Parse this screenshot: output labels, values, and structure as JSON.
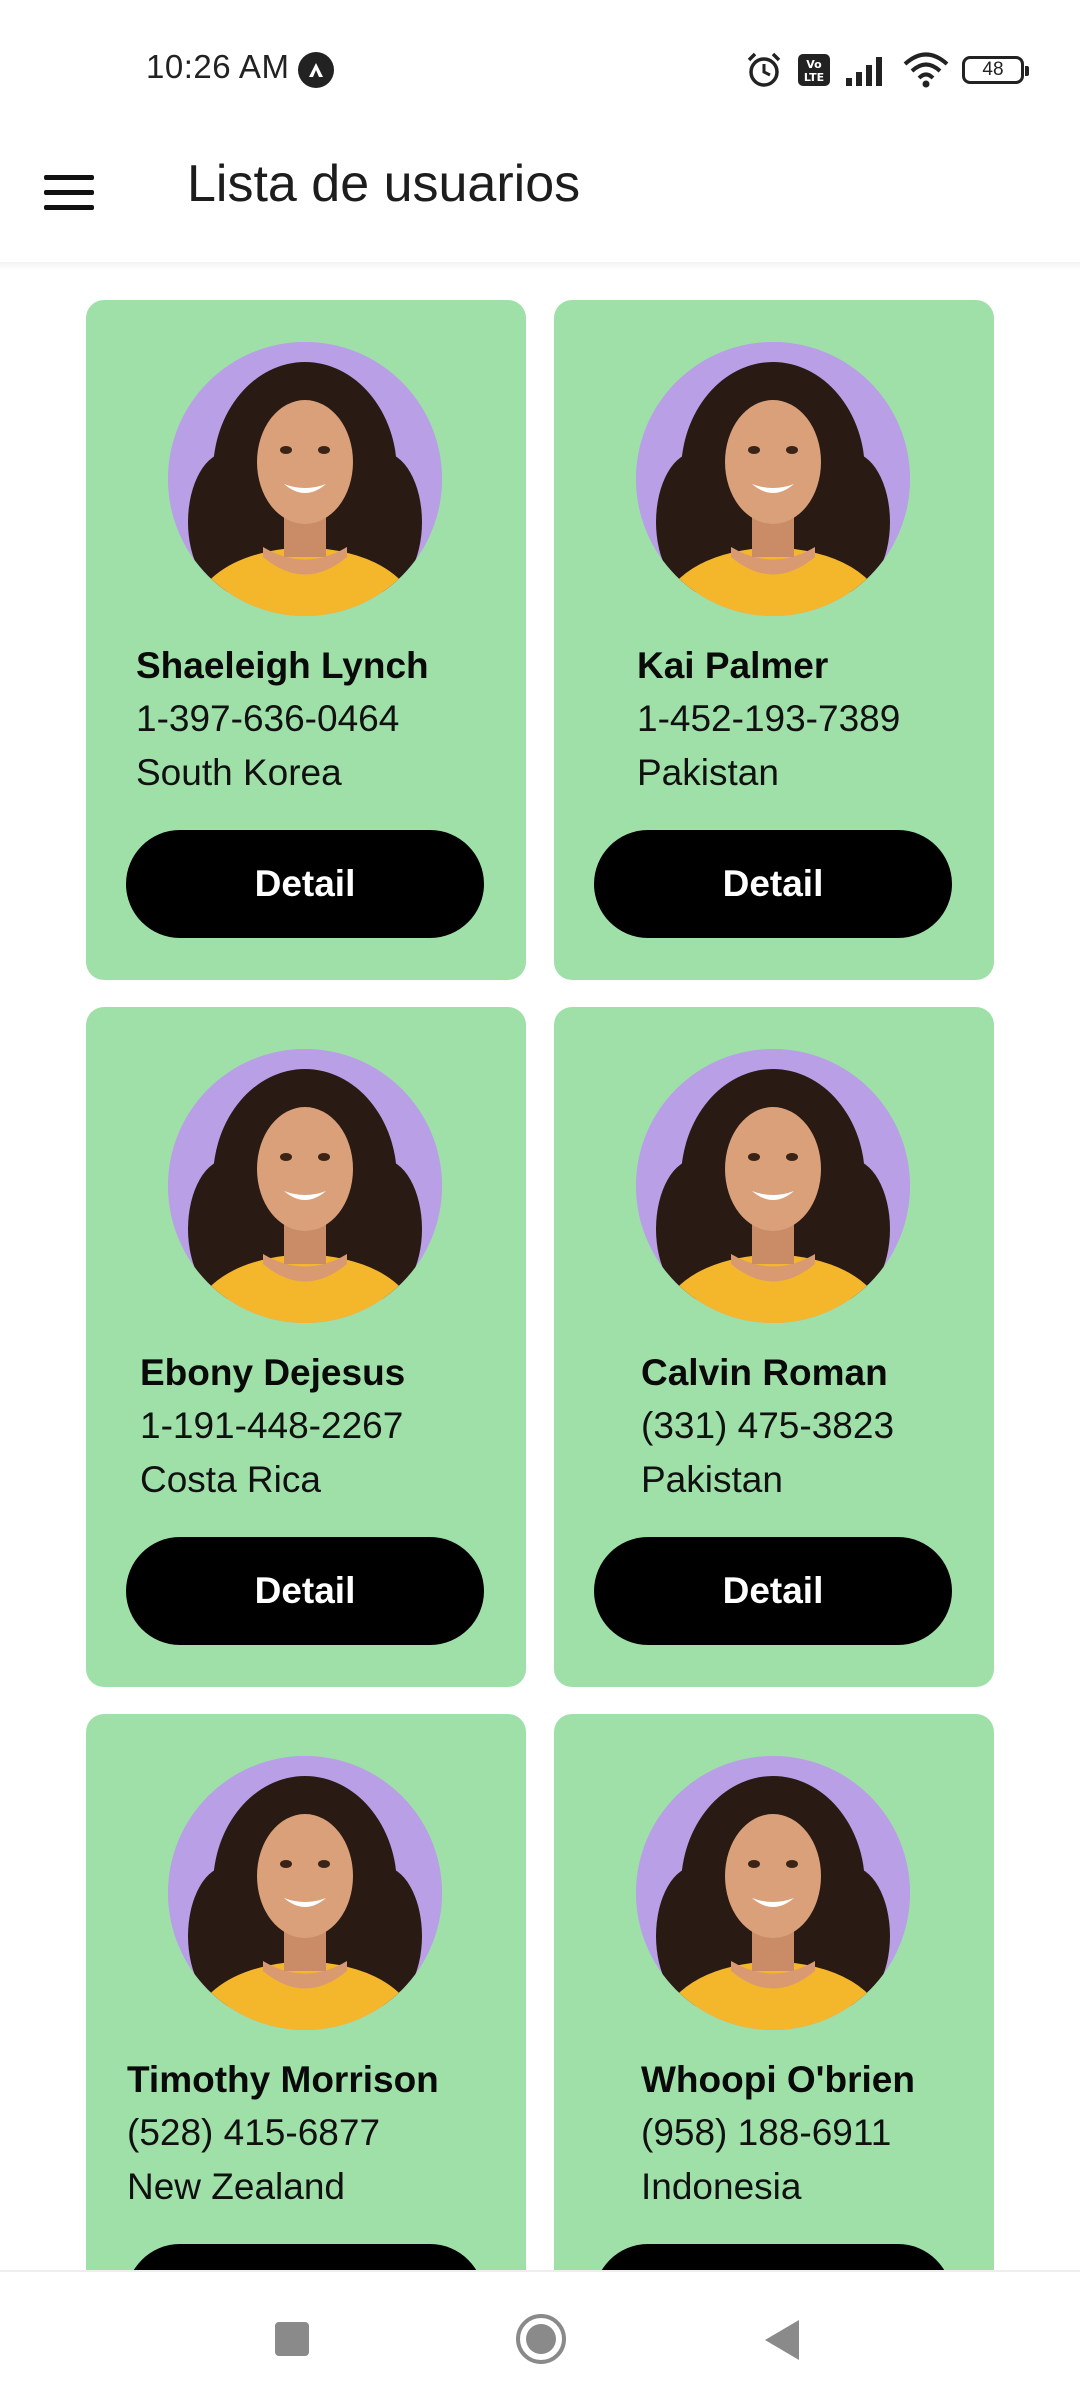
{
  "status_bar": {
    "time": "10:26 AM",
    "battery": "48",
    "icons": [
      "alarm-icon",
      "volte-icon",
      "signal-icon",
      "wifi-icon",
      "battery-icon"
    ]
  },
  "app_bar": {
    "title": "Lista de usuarios",
    "menu_icon": "hamburger-menu-icon"
  },
  "users": [
    {
      "name": "Shaeleigh Lynch",
      "phone": "1-397-636-0464",
      "country": "South Korea",
      "button": "Detail"
    },
    {
      "name": "Kai Palmer",
      "phone": "1-452-193-7389",
      "country": "Pakistan",
      "button": "Detail"
    },
    {
      "name": "Ebony Dejesus",
      "phone": "1-191-448-2267",
      "country": "Costa Rica",
      "button": "Detail"
    },
    {
      "name": "Calvin Roman",
      "phone": "(331) 475-3823",
      "country": "Pakistan",
      "button": "Detail"
    },
    {
      "name": "Timothy Morrison",
      "phone": "(528) 415-6877",
      "country": "New Zealand",
      "button": "Detail"
    },
    {
      "name": "Whoopi O'brien",
      "phone": "(958) 188-6911",
      "country": "Indonesia",
      "button": "Detail"
    }
  ],
  "colors": {
    "card_background": "#9FE0A9",
    "avatar_background": "#B9A0E6",
    "button_background": "#000000",
    "button_text": "#FFFFFF"
  },
  "nav_bar": {
    "icons": [
      "recent-apps-icon",
      "home-icon",
      "back-icon"
    ]
  }
}
